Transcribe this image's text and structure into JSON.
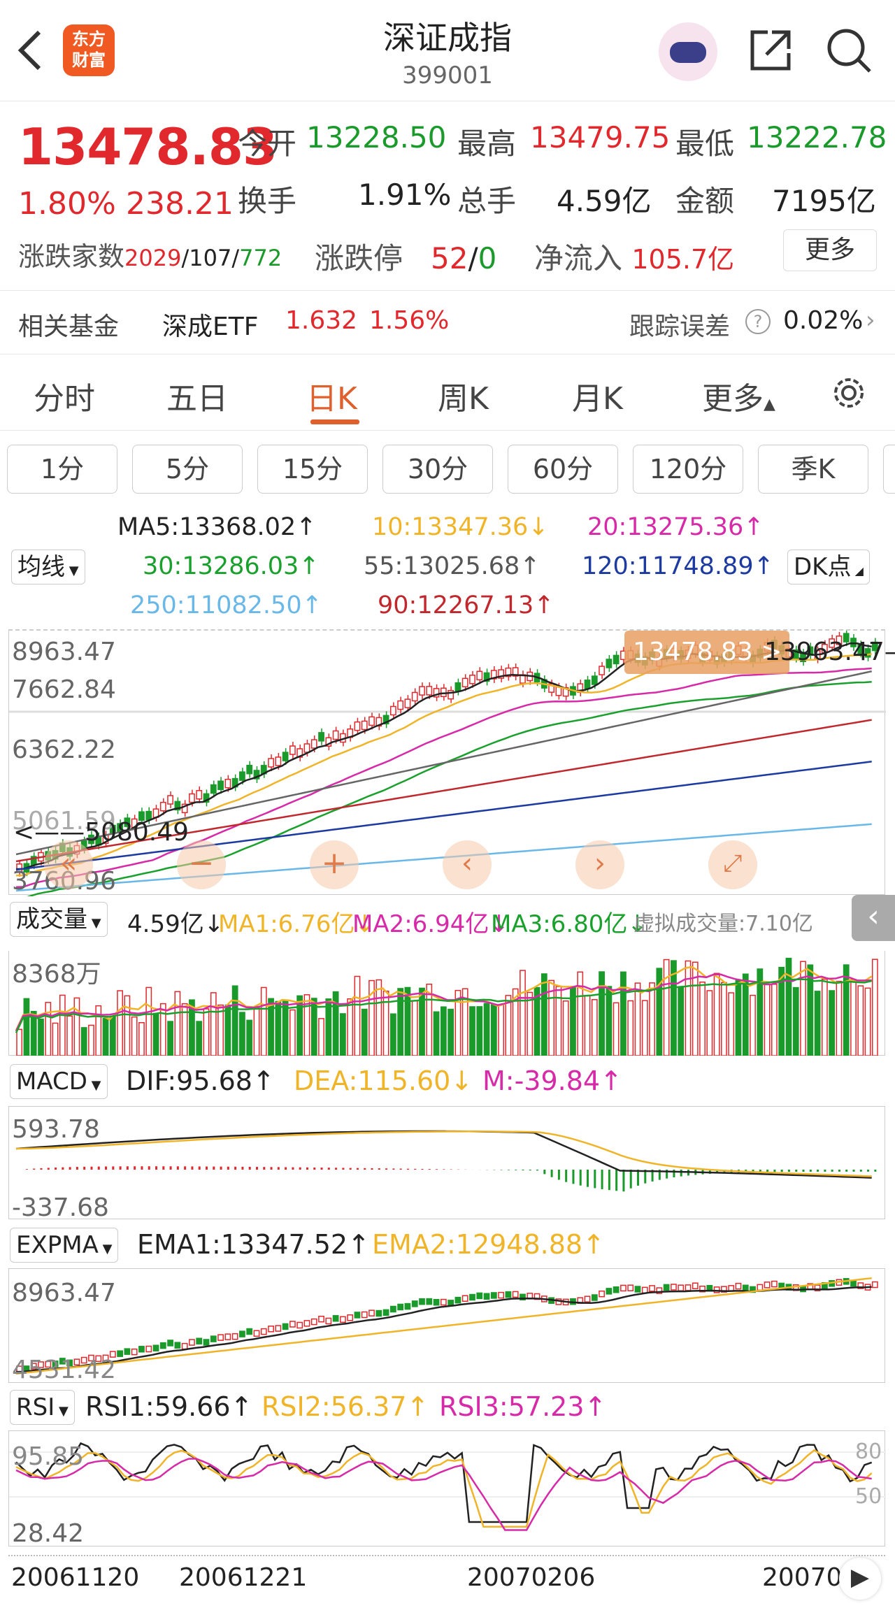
{
  "header": {
    "back_icon": "chevron-left-icon",
    "logo_line1": "东方",
    "logo_line2": "财富",
    "title": "深证成指",
    "code": "399001",
    "share_icon": "share-icon",
    "search_icon": "search-icon"
  },
  "quote": {
    "price": "13478.83",
    "change_pct": "1.80%",
    "change": "238.21",
    "open_label": "今开",
    "open": "13228.50",
    "high_label": "最高",
    "high": "13479.75",
    "low_label": "最低",
    "low": "13222.78",
    "turnover_label": "换手",
    "turnover": "1.91%",
    "volume_label": "总手",
    "volume": "4.59亿",
    "amount_label": "金额",
    "amount": "7195亿",
    "breadth_label": "涨跌家数",
    "up_count": "2029",
    "flat_count": "107",
    "down_count": "772",
    "limit_label": "涨跌停",
    "limit_up": "52",
    "limit_down": "0",
    "inflow_label": "净流入",
    "inflow": "105.7亿",
    "more_label": "更多"
  },
  "fund": {
    "label": "相关基金",
    "name": "深成ETF",
    "price": "1.632",
    "pct": "1.56%",
    "tracking_label": "跟踪误差",
    "tracking": "0.02%"
  },
  "tabs": [
    "分时",
    "五日",
    "日K",
    "周K",
    "月K",
    "更多"
  ],
  "periods": [
    "1分",
    "5分",
    "15分",
    "30分",
    "60分",
    "120分",
    "季K"
  ],
  "ma": {
    "dropdown": "均线",
    "dk": "DK点",
    "ma5": "MA5:13368.02",
    "ma10": "10:13347.36",
    "ma20": "20:13275.36",
    "ma30": "30:13286.03",
    "ma55": "55:13025.68",
    "ma120": "120:11748.89",
    "ma250": "250:11082.50",
    "ma90": "90:12267.13"
  },
  "kline": {
    "y_top": "8963.47",
    "y_2": "7662.84",
    "y_3": "6362.22",
    "y_4": "5061.59",
    "y_bottom": "3760.96",
    "low_marker": "5080.49",
    "last_marker": "13478.83",
    "high_marker": "13963.47"
  },
  "volume": {
    "dropdown": "成交量",
    "vol": "4.59亿",
    "ma1": "MA1:6.76亿",
    "ma2": "MA2:6.94亿",
    "ma3": "MA3:6.80亿",
    "virtual": "虚拟成交量:7.10亿",
    "y_top": "8368万"
  },
  "macd": {
    "dropdown": "MACD",
    "dif": "DIF:95.68",
    "dea": "DEA:115.60",
    "m": "M:-39.84",
    "y_top": "593.78",
    "y_bottom": "-337.68"
  },
  "expma": {
    "dropdown": "EXPMA",
    "ema1": "EMA1:13347.52",
    "ema2": "EMA2:12948.88",
    "y_top": "8963.47",
    "y_bottom": "4531.42"
  },
  "rsi": {
    "dropdown": "RSI",
    "rsi1": "RSI1:59.66",
    "rsi2": "RSI2:56.37",
    "rsi3": "RSI3:57.23",
    "y_top": "95.85",
    "y_bottom": "28.42",
    "level_80": "80",
    "level_50": "50"
  },
  "dates": [
    "20061120",
    "20061221",
    "20070206",
    "20070"
  ],
  "colors": {
    "up": "#e0282d",
    "down": "#1a9a2a",
    "accent": "#e0602d",
    "ma5": "#222222",
    "ma10": "#f0b429",
    "ma20": "#d62aa8",
    "ma30": "#1aa02c",
    "ma55": "#666666",
    "ma90": "#c0282d",
    "ma120": "#1c3aa0",
    "ma250": "#6ab8e8"
  }
}
